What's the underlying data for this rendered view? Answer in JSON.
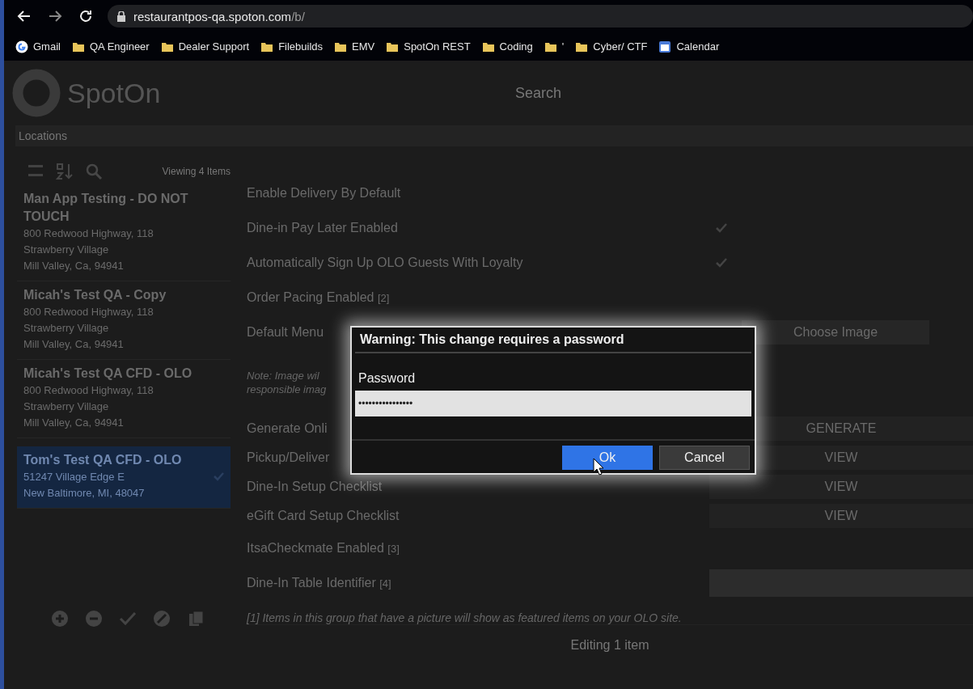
{
  "browser": {
    "url_host": "restaurantpos-qa.spoton.com",
    "url_path": "/b/",
    "bookmarks": [
      {
        "kind": "google",
        "label": "Gmail"
      },
      {
        "kind": "folder",
        "label": "QA Engineer"
      },
      {
        "kind": "folder",
        "label": "Dealer Support"
      },
      {
        "kind": "folder",
        "label": "Filebuilds"
      },
      {
        "kind": "folder",
        "label": "EMV"
      },
      {
        "kind": "folder",
        "label": "SpotOn REST"
      },
      {
        "kind": "folder",
        "label": "Coding"
      },
      {
        "kind": "folder",
        "label": "'"
      },
      {
        "kind": "folder",
        "label": "Cyber/ CTF"
      },
      {
        "kind": "calendar",
        "label": "Calendar"
      }
    ]
  },
  "header": {
    "logo": "SpotOn",
    "search_placeholder": "Search"
  },
  "section_title": "Locations",
  "sidebar": {
    "viewing": "Viewing 4 Items",
    "items": [
      {
        "name": "Man App Testing - DO NOT TOUCH",
        "address": [
          "800 Redwood Highway, 118",
          "Strawberry Village",
          "Mill Valley, Ca, 94941"
        ],
        "selected": false
      },
      {
        "name": "Micah's Test QA - Copy",
        "address": [
          "800 Redwood Highway, 118",
          "Strawberry Village",
          "Mill Valley, Ca, 94941"
        ],
        "selected": false
      },
      {
        "name": "Micah's Test QA CFD - OLO",
        "address": [
          "800 Redwood Highway, 118",
          "Strawberry Village",
          "Mill Valley, Ca, 94941"
        ],
        "selected": false
      },
      {
        "name": "Tom's Test QA CFD - OLO",
        "address": [
          "51247 Village Edge E",
          "New Baltimore, MI, 48047"
        ],
        "selected": true
      }
    ]
  },
  "settings": [
    {
      "kind": "check",
      "label": "Enable Delivery By Default",
      "checked": false
    },
    {
      "kind": "check",
      "label": "Dine-in Pay Later Enabled",
      "checked": true
    },
    {
      "kind": "check",
      "label": "Automatically Sign Up OLO Guests With Loyalty",
      "checked": true
    },
    {
      "kind": "check",
      "label": "Order Pacing Enabled",
      "ref": "[2]",
      "checked": false
    },
    {
      "kind": "image",
      "label": "Default Menu",
      "action": "Choose Image"
    },
    {
      "kind": "note",
      "lines": [
        "Note: Image wil",
        "responsible imag"
      ]
    },
    {
      "kind": "button",
      "label": "Generate Onli",
      "action": "GENERATE"
    },
    {
      "kind": "button",
      "label": "Pickup/Deliver",
      "action": "VIEW"
    },
    {
      "kind": "button",
      "label": "Dine-In Setup Checklist",
      "action": "VIEW"
    },
    {
      "kind": "button",
      "label": "eGift Card Setup Checklist",
      "action": "VIEW"
    },
    {
      "kind": "check",
      "label": "ItsaCheckmate Enabled",
      "ref": "[3]",
      "checked": false
    },
    {
      "kind": "field",
      "label": "Dine-In Table Identifier",
      "ref": "[4]"
    },
    {
      "kind": "footnote",
      "text": "[1] Items in this group that have a picture will show as featured items on your OLO site."
    }
  ],
  "footer": {
    "status": "Editing 1 item"
  },
  "dialog": {
    "title": "Warning: This change requires a password",
    "field_label": "Password",
    "value": "••••••••••••••••",
    "buttons": [
      {
        "label": "Ok",
        "primary": true
      },
      {
        "label": "Cancel",
        "primary": false
      }
    ]
  }
}
